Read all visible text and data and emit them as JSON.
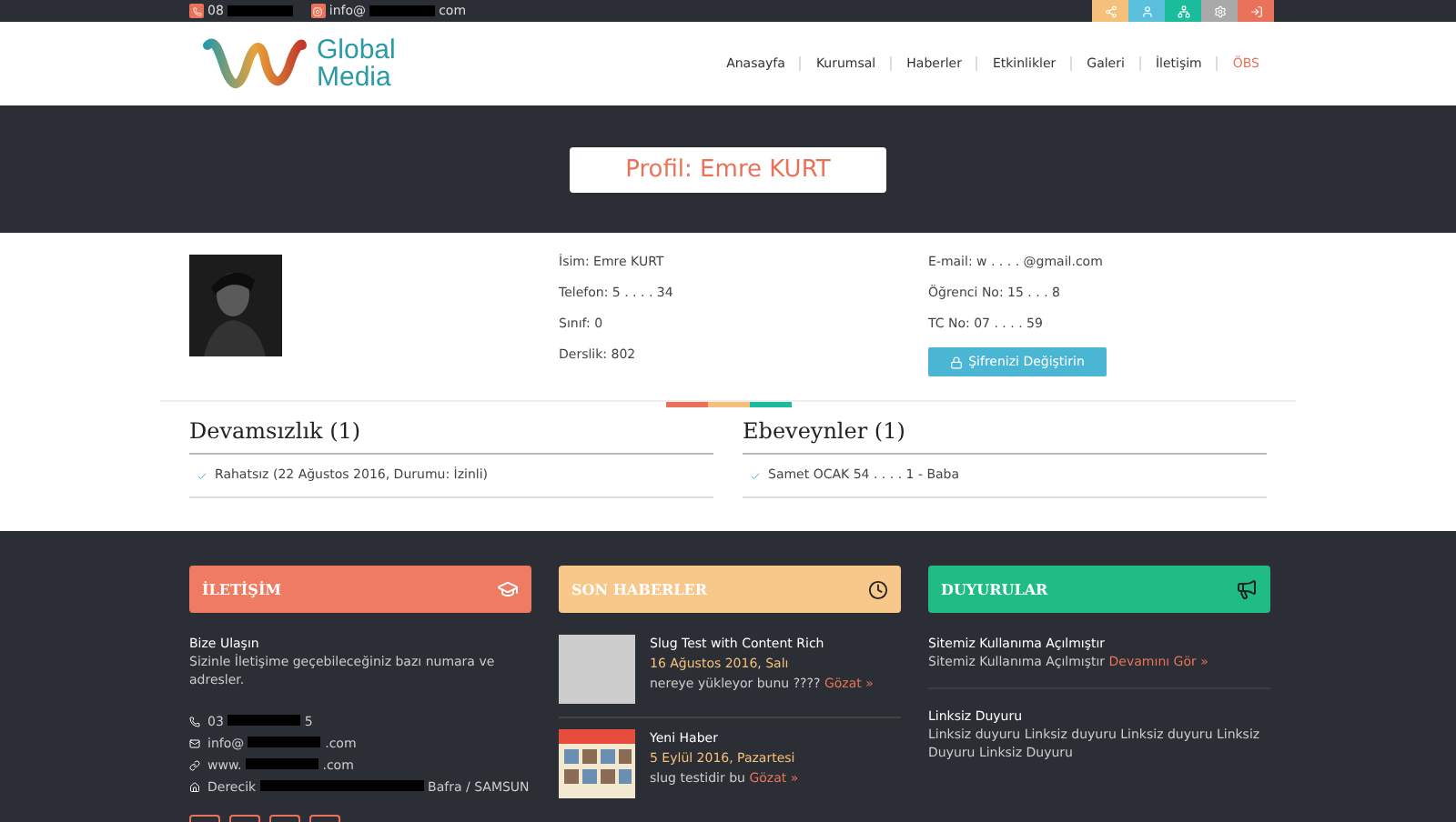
{
  "topbar": {
    "phone": "08",
    "email_start": "info@",
    "email_end": "com",
    "social": [
      {
        "color": "#f5c07a"
      },
      {
        "color": "#5bc0de"
      },
      {
        "color": "#1abc9c"
      },
      {
        "color": "#a9a9a9"
      },
      {
        "color": "#e8735a"
      }
    ]
  },
  "logo": {
    "line1": "Global",
    "line2": "Media"
  },
  "nav": [
    {
      "label": "Anasayfa",
      "highlight": false
    },
    {
      "label": "Kurumsal",
      "highlight": false
    },
    {
      "label": "Haberler",
      "highlight": false
    },
    {
      "label": "Etkinlikler",
      "highlight": false
    },
    {
      "label": "Galeri",
      "highlight": false
    },
    {
      "label": "İletişim",
      "highlight": false
    },
    {
      "label": "ÖBS",
      "highlight": true
    }
  ],
  "banner": {
    "title": "Profil: Emre KURT"
  },
  "profile": {
    "col1": [
      "İsim: Emre KURT",
      "Telefon: 5 . . . . 34",
      "Sınıf: 0",
      "Derslik: 802"
    ],
    "col2": [
      "E-mail: w . . . . @gmail.com",
      "Öğrenci No: 15 . . . 8",
      "TC No: 07 . . . . 59"
    ],
    "button": "Şifrenizi Değiştirin"
  },
  "panels": [
    {
      "title": "Devamsızlık (1)",
      "items": [
        "Rahatsız (22 Ağustos 2016, Durumu: İzinli)"
      ]
    },
    {
      "title": "Ebeveynler (1)",
      "items": [
        "Samet OCAK 54 . . . . 1 - Baba"
      ]
    }
  ],
  "footer": {
    "contact": {
      "title": "İLETİŞİM",
      "heading": "Bize Ulaşın",
      "text": "Sizinle İletişime geçebileceğiniz bazı numara ve adresler.",
      "lines": [
        {
          "start": "03",
          "end": "5"
        },
        {
          "start": "info@",
          "end": ".com"
        },
        {
          "start": "www.",
          "end": ".com"
        },
        {
          "start": "Derecik",
          "end": "Bafra / SAMSUN"
        }
      ]
    },
    "news": {
      "title": "SON HABERLER",
      "items": [
        {
          "title": "Slug Test with Content Rich",
          "date": "16 Ağustos 2016, Salı",
          "text": "nereye yükleyor bunu ????",
          "link": "Gözat »",
          "kind": "placeholder"
        },
        {
          "title": "Yeni Haber",
          "date": "5 Eylül 2016, Pazartesi",
          "text": "slug testidir bu",
          "link": "Gözat »",
          "kind": "picture"
        }
      ]
    },
    "announcements": {
      "title": "DUYURULAR",
      "items": [
        {
          "title": "Sitemiz Kullanıma Açılmıştır",
          "text": "Sitemiz Kullanıma Açılmıştır",
          "link": "Devamını Gör »"
        },
        {
          "title": "Linksiz Duyuru",
          "text": "Linksiz duyuru Linksiz duyuru Linksiz duyuru Linksiz Duyuru Linksiz Duyuru"
        }
      ]
    }
  }
}
